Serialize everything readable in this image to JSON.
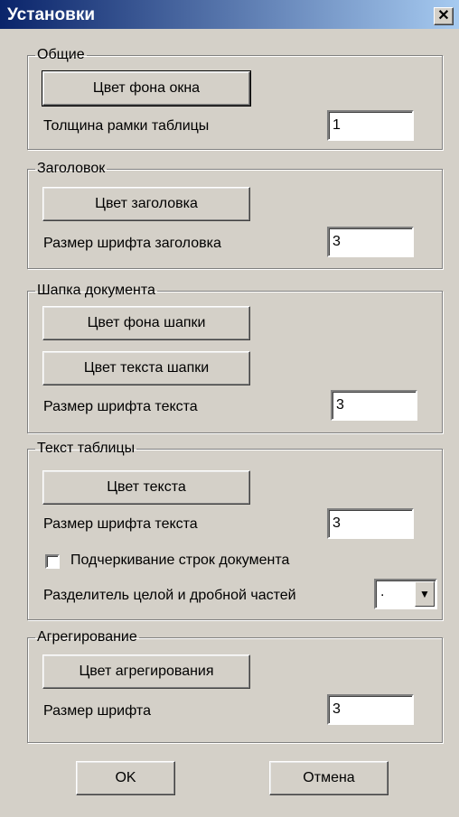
{
  "window": {
    "title": "Установки"
  },
  "groups": {
    "general": {
      "title": "Общие",
      "bg_color_button": "Цвет фона окна",
      "border_label": "Толщина рамки таблицы",
      "border_value": "1"
    },
    "header": {
      "title": "Заголовок",
      "color_button": "Цвет заголовка",
      "font_size_label": "Размер шрифта заголовка",
      "font_size_value": "3"
    },
    "doc_head": {
      "title": "Шапка документа",
      "bg_color_button": "Цвет фона шапки",
      "text_color_button": "Цвет текста шапки",
      "font_size_label": "Размер шрифта текста",
      "font_size_value": "3"
    },
    "table_text": {
      "title": "Текст таблицы",
      "color_button": "Цвет текста",
      "font_size_label": "Размер шрифта текста",
      "font_size_value": "3",
      "underline_label": "Подчеркивание строк документа",
      "underline_checked": false,
      "separator_label": "Разделитель целой и дробной частей",
      "separator_value": "."
    },
    "aggregation": {
      "title": "Агрегирование",
      "color_button": "Цвет агрегирования",
      "font_size_label": "Размер шрифта",
      "font_size_value": "3"
    }
  },
  "footer": {
    "ok_label": "OK",
    "cancel_label": "Отмена"
  }
}
